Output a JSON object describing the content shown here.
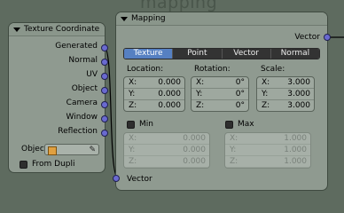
{
  "bg_title": "mapping",
  "tex_node": {
    "header": "Texture Coordinate",
    "outputs": [
      "Generated",
      "Normal",
      "UV",
      "Object",
      "Camera",
      "Window",
      "Reflection"
    ],
    "object_label": "Objec",
    "from_dupli_label": "From Dupli"
  },
  "map_node": {
    "header": "Mapping",
    "output_label": "Vector",
    "tabs": [
      "Texture",
      "Point",
      "Vector",
      "Normal"
    ],
    "active_tab": "Texture",
    "location_label": "Location:",
    "rotation_label": "Rotation:",
    "scale_label": "Scale:",
    "location": [
      {
        "axis": "X:",
        "value": "0.000"
      },
      {
        "axis": "Y:",
        "value": "0.000"
      },
      {
        "axis": "Z:",
        "value": "0.000"
      }
    ],
    "rotation": [
      {
        "axis": "X:",
        "value": "0°"
      },
      {
        "axis": "Y:",
        "value": "0°"
      },
      {
        "axis": "Z:",
        "value": "0°"
      }
    ],
    "scale": [
      {
        "axis": "X:",
        "value": "3.000"
      },
      {
        "axis": "Y:",
        "value": "3.000"
      },
      {
        "axis": "Z:",
        "value": "3.000"
      }
    ],
    "min_label": "Min",
    "max_label": "Max",
    "min": [
      {
        "axis": "X:",
        "value": "0.000"
      },
      {
        "axis": "Y:",
        "value": "0.000"
      },
      {
        "axis": "Z:",
        "value": "0.000"
      }
    ],
    "max": [
      {
        "axis": "X:",
        "value": "1.000"
      },
      {
        "axis": "Y:",
        "value": "1.000"
      },
      {
        "axis": "Z:",
        "value": "1.000"
      }
    ],
    "input_label": "Vector"
  },
  "colors": {
    "socket": "#6a6ad0",
    "active_tab": "#5680c2",
    "link": "#000000"
  }
}
